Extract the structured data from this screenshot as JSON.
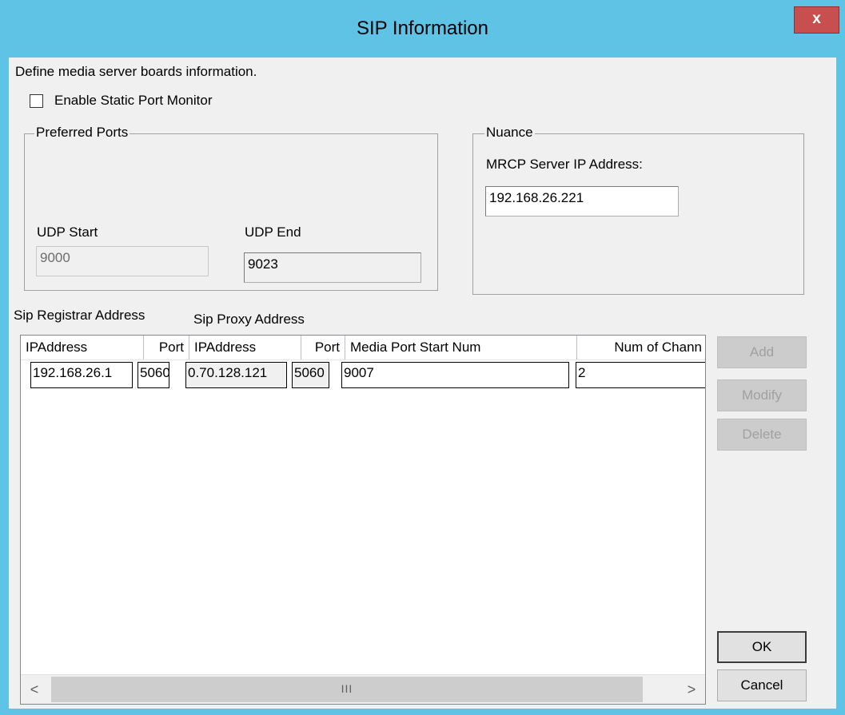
{
  "window": {
    "title": "SIP Information",
    "close_label": "x"
  },
  "description": "Define media server boards information.",
  "static_port_monitor": {
    "label": "Enable Static Port Monitor",
    "checked": false
  },
  "preferred_ports": {
    "title": "Preferred Ports",
    "udp_start_label": "UDP Start",
    "udp_start_value": "9000",
    "udp_end_label": "UDP End",
    "udp_end_value": "9023"
  },
  "nuance": {
    "title": "Nuance",
    "mrcp_label": "MRCP Server IP Address:",
    "mrcp_value": "192.168.26.221"
  },
  "table_labels": {
    "registrar": "Sip Registrar Address",
    "proxy": "Sip Proxy Address"
  },
  "table": {
    "columns": [
      "IPAddress",
      "Port",
      "IPAddress",
      "Port",
      "Media Port Start Num",
      "Num of Chann"
    ],
    "row": {
      "registrar_ip": "192.168.26.1",
      "registrar_port": "5060",
      "proxy_ip": "0.70.128.121",
      "proxy_port": "5060",
      "media_port_start": "9007",
      "num_channels": "2"
    },
    "scrollbar": {
      "left_arrow": "<",
      "thumb_grip": "III",
      "right_arrow": ">"
    }
  },
  "buttons": {
    "add": "Add",
    "modify": "Modify",
    "delete": "Delete",
    "ok": "OK",
    "cancel": "Cancel"
  }
}
